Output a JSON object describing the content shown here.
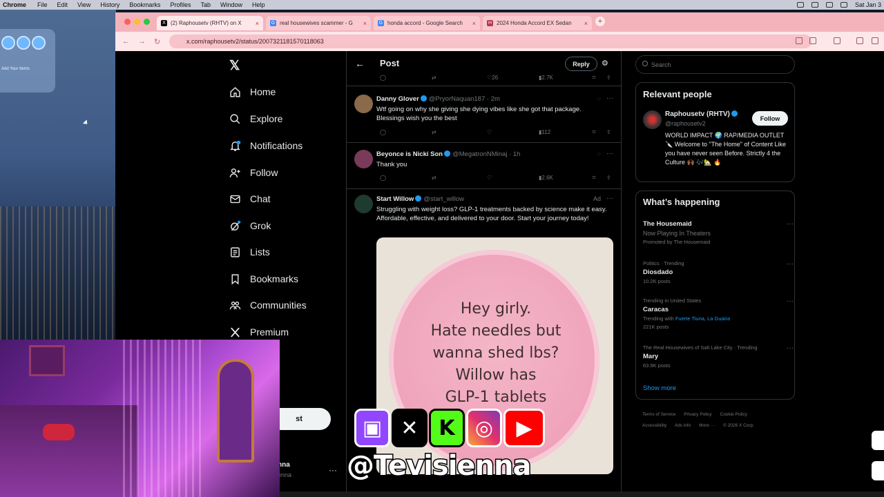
{
  "menubar": {
    "app": "Chrome",
    "items": [
      "File",
      "Edit",
      "View",
      "History",
      "Bookmarks",
      "Profiles",
      "Tab",
      "Window",
      "Help"
    ],
    "clock": "Sat Jan 3"
  },
  "desktop": {
    "widget_label": "Add Your Items"
  },
  "browser": {
    "tabs": [
      {
        "title": "(2) Raphousetv (RHTV) on X",
        "favicon": "X",
        "active": true
      },
      {
        "title": "real housewives scammer - G",
        "favicon": "G",
        "active": false
      },
      {
        "title": "honda accord - Google Search",
        "favicon": "G",
        "active": false
      },
      {
        "title": "2024 Honda Accord EX Sedan",
        "favicon": "H",
        "active": false
      }
    ],
    "url": "x.com/raphousetv2/status/2007321181570118063"
  },
  "x": {
    "nav": [
      {
        "label": "Home",
        "icon": "home-icon"
      },
      {
        "label": "Explore",
        "icon": "search-icon"
      },
      {
        "label": "Notifications",
        "icon": "bell-icon",
        "badge": "2"
      },
      {
        "label": "Follow",
        "icon": "add-person-icon"
      },
      {
        "label": "Chat",
        "icon": "mail-icon"
      },
      {
        "label": "Grok",
        "icon": "grok-icon"
      },
      {
        "label": "Lists",
        "icon": "list-icon"
      },
      {
        "label": "Bookmarks",
        "icon": "bookmark-icon"
      },
      {
        "label": "Communities",
        "icon": "people-icon"
      },
      {
        "label": "Premium",
        "icon": "x-icon"
      }
    ],
    "post_button": "st",
    "account": {
      "name_fragment": "nna",
      "handle_fragment": "enna",
      "more": "···"
    },
    "header": {
      "title": "Post",
      "reply_label": "Reply"
    },
    "top_actions": {
      "likes": "26",
      "views": "2.7K"
    },
    "replies": [
      {
        "name": "Danny Glover",
        "handle": "@PryorNaquan187 · 2m",
        "text": "Wtf going on why she giving she dying vibes like she got that package. Blessings wish you the best",
        "views": "112",
        "avatar_color": "#8a6a4a"
      },
      {
        "name": "Beyonce is Nicki Son",
        "handle": "@MegatronNMinaj · 1h",
        "text": "Thank you",
        "views": "2.6K",
        "avatar_color": "#7a3a5a"
      }
    ],
    "ad": {
      "name": "Start Willow",
      "handle": "@start_willow",
      "badge": "Ad",
      "text": "Struggling with weight loss? GLP-1 treatments backed by science make it easy. Affordable, effective, and delivered to your door. Start your journey today!",
      "image_text": [
        "Hey girly.",
        "Hate needles but",
        "wanna shed lbs?",
        "Willow has",
        "GLP-1 tablets"
      ]
    },
    "search_placeholder": "Search",
    "relevant": {
      "title": "Relevant people",
      "name": "Raphousetv (RHTV)",
      "handle": "@raphousetv2",
      "follow_label": "Follow",
      "bio": "WORLD IMPACT 🌍 RAP/MEDIA OUTLET 🔪 Welcome to \"The Home\" of Content Like you have never seen Before. Strictly 4 the Culture 🙌🏾 🎶🏡 🔥"
    },
    "happening": {
      "title": "What’s happening",
      "trends": [
        {
          "context": "",
          "title": "The Housemaid",
          "sub": "Now Playing In Theaters",
          "extra": "Promoted by The Housemaid"
        },
        {
          "context": "Politics · Trending",
          "title": "Diosdado",
          "sub": "10.2K posts",
          "extra": ""
        },
        {
          "context": "Trending in United States",
          "title": "Caracas",
          "sub_prefix": "Trending with ",
          "links": "Fuerte Tiuna, La Guaira",
          "sub": "221K posts",
          "extra": ""
        },
        {
          "context": "The Real Housewives of Salt Lake City · Trending",
          "title": "Mary",
          "sub": "63.9K posts",
          "extra": ""
        }
      ],
      "show_more": "Show more"
    },
    "footer": [
      "Terms of Service",
      "Privacy Policy",
      "Cookie Policy",
      "Accessibility",
      "Ads info",
      "More ···",
      "© 2026 X Corp."
    ]
  },
  "overlay": {
    "handle": "@Tevisienna",
    "icons": [
      "twitch-icon",
      "x-icon",
      "kick-icon",
      "instagram-icon",
      "youtube-icon"
    ]
  },
  "colors": {
    "accent": "#1d9bf0",
    "tab_bar": "#f3b3bb",
    "toolbar": "#fde7e9",
    "background": "#000000"
  }
}
